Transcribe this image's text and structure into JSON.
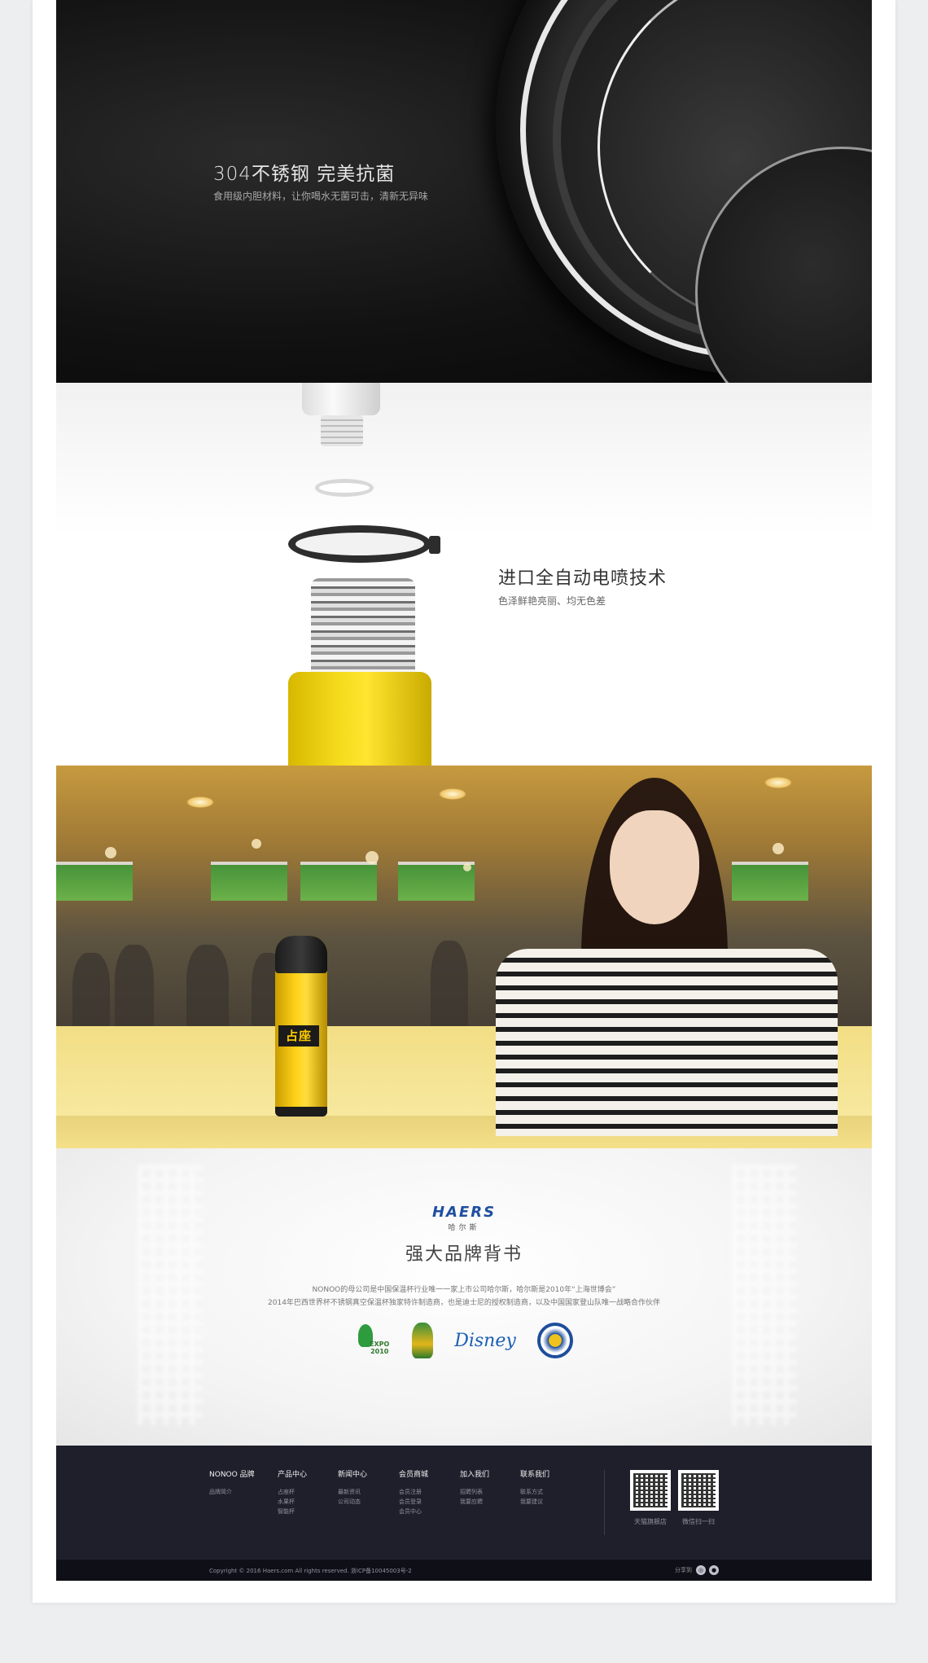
{
  "feature_steel": {
    "title": "304不锈钢 完美抗菌",
    "subtitle": "食用级内胆材料，让你喝水无菌可击，清新无异味"
  },
  "feature_spray": {
    "title": "进口全自动电喷技术",
    "subtitle": "色泽鲜艳亮丽、均无色差"
  },
  "lifestyle": {
    "thermos_label": "占座"
  },
  "brand": {
    "logo_text": "HAERS",
    "logo_sub": "哈尔斯",
    "title": "强大品牌背书",
    "desc_line1": "NONOO的母公司是中国保温杯行业唯一一家上市公司哈尔斯，哈尔斯是2010年“上海世博会”",
    "desc_line2": "2014年巴西世界杯不锈钢真空保温杯独家特许制造商，也是迪士尼的授权制造商，以及中国国家登山队唯一战略合作伙伴",
    "partner_logos": [
      "expo-2010-logo",
      "world-cup-2014-logo",
      "disney-logo",
      "mountaineering-team-logo"
    ],
    "expo_text": "EXPO 2010",
    "disney_text": "Disney"
  },
  "footer": {
    "columns": [
      {
        "heading": "NONOO 品牌",
        "items": [
          "品牌简介"
        ]
      },
      {
        "heading": "产品中心",
        "items": [
          "占座杯",
          "水果杯",
          "智能杯"
        ]
      },
      {
        "heading": "新闻中心",
        "items": [
          "最新资讯",
          "公司动态"
        ]
      },
      {
        "heading": "会员商城",
        "items": [
          "会员注册",
          "会员登录",
          "会员中心"
        ]
      },
      {
        "heading": "加入我们",
        "items": [
          "招聘列表",
          "我要应聘"
        ]
      },
      {
        "heading": "联系我们",
        "items": [
          "联系方式",
          "我要建议"
        ]
      }
    ],
    "qr_codes": [
      {
        "label": "天猫旗舰店"
      },
      {
        "label": "微信扫一扫"
      }
    ],
    "copyright": "Copyright © 2016 Haers.com All rights reserved. 浙ICP备10045003号-2",
    "share_label": "分享到",
    "social_icons": [
      "weibo-icon",
      "qq-icon"
    ]
  },
  "colors": {
    "footer_bg": "#1e1f2b",
    "subfooter_bg": "#0f1017",
    "brand_blue": "#1f4fa0",
    "bottle_yellow": "#ffd21a"
  }
}
